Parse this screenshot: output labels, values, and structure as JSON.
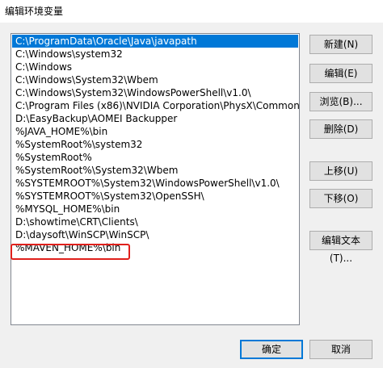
{
  "window": {
    "title": "编辑环境变量"
  },
  "paths": [
    "C:\\ProgramData\\Oracle\\Java\\javapath",
    "C:\\Windows\\system32",
    "C:\\Windows",
    "C:\\Windows\\System32\\Wbem",
    "C:\\Windows\\System32\\WindowsPowerShell\\v1.0\\",
    "C:\\Program Files (x86)\\NVIDIA Corporation\\PhysX\\Common",
    "D:\\EasyBackup\\AOMEI Backupper",
    "%JAVA_HOME%\\bin",
    "%SystemRoot%\\system32",
    "%SystemRoot%",
    "%SystemRoot%\\System32\\Wbem",
    "%SYSTEMROOT%\\System32\\WindowsPowerShell\\v1.0\\",
    "%SYSTEMROOT%\\System32\\OpenSSH\\",
    "%MYSQL_HOME%\\bin",
    "D:\\showtime\\CRT\\Clients\\",
    "D:\\daysoft\\WinSCP\\WinSCP\\",
    "%MAVEN_HOME%\\bin"
  ],
  "selected_index": 0,
  "buttons": {
    "new": "新建(N)",
    "edit": "编辑(E)",
    "browse": "浏览(B)...",
    "delete": "删除(D)",
    "move_up": "上移(U)",
    "move_down": "下移(O)",
    "edit_text": "编辑文本(T)..."
  },
  "footer": {
    "ok": "确定",
    "cancel": "取消"
  },
  "colors": {
    "selection": "#0078d7",
    "highlight": "#e0201c"
  }
}
